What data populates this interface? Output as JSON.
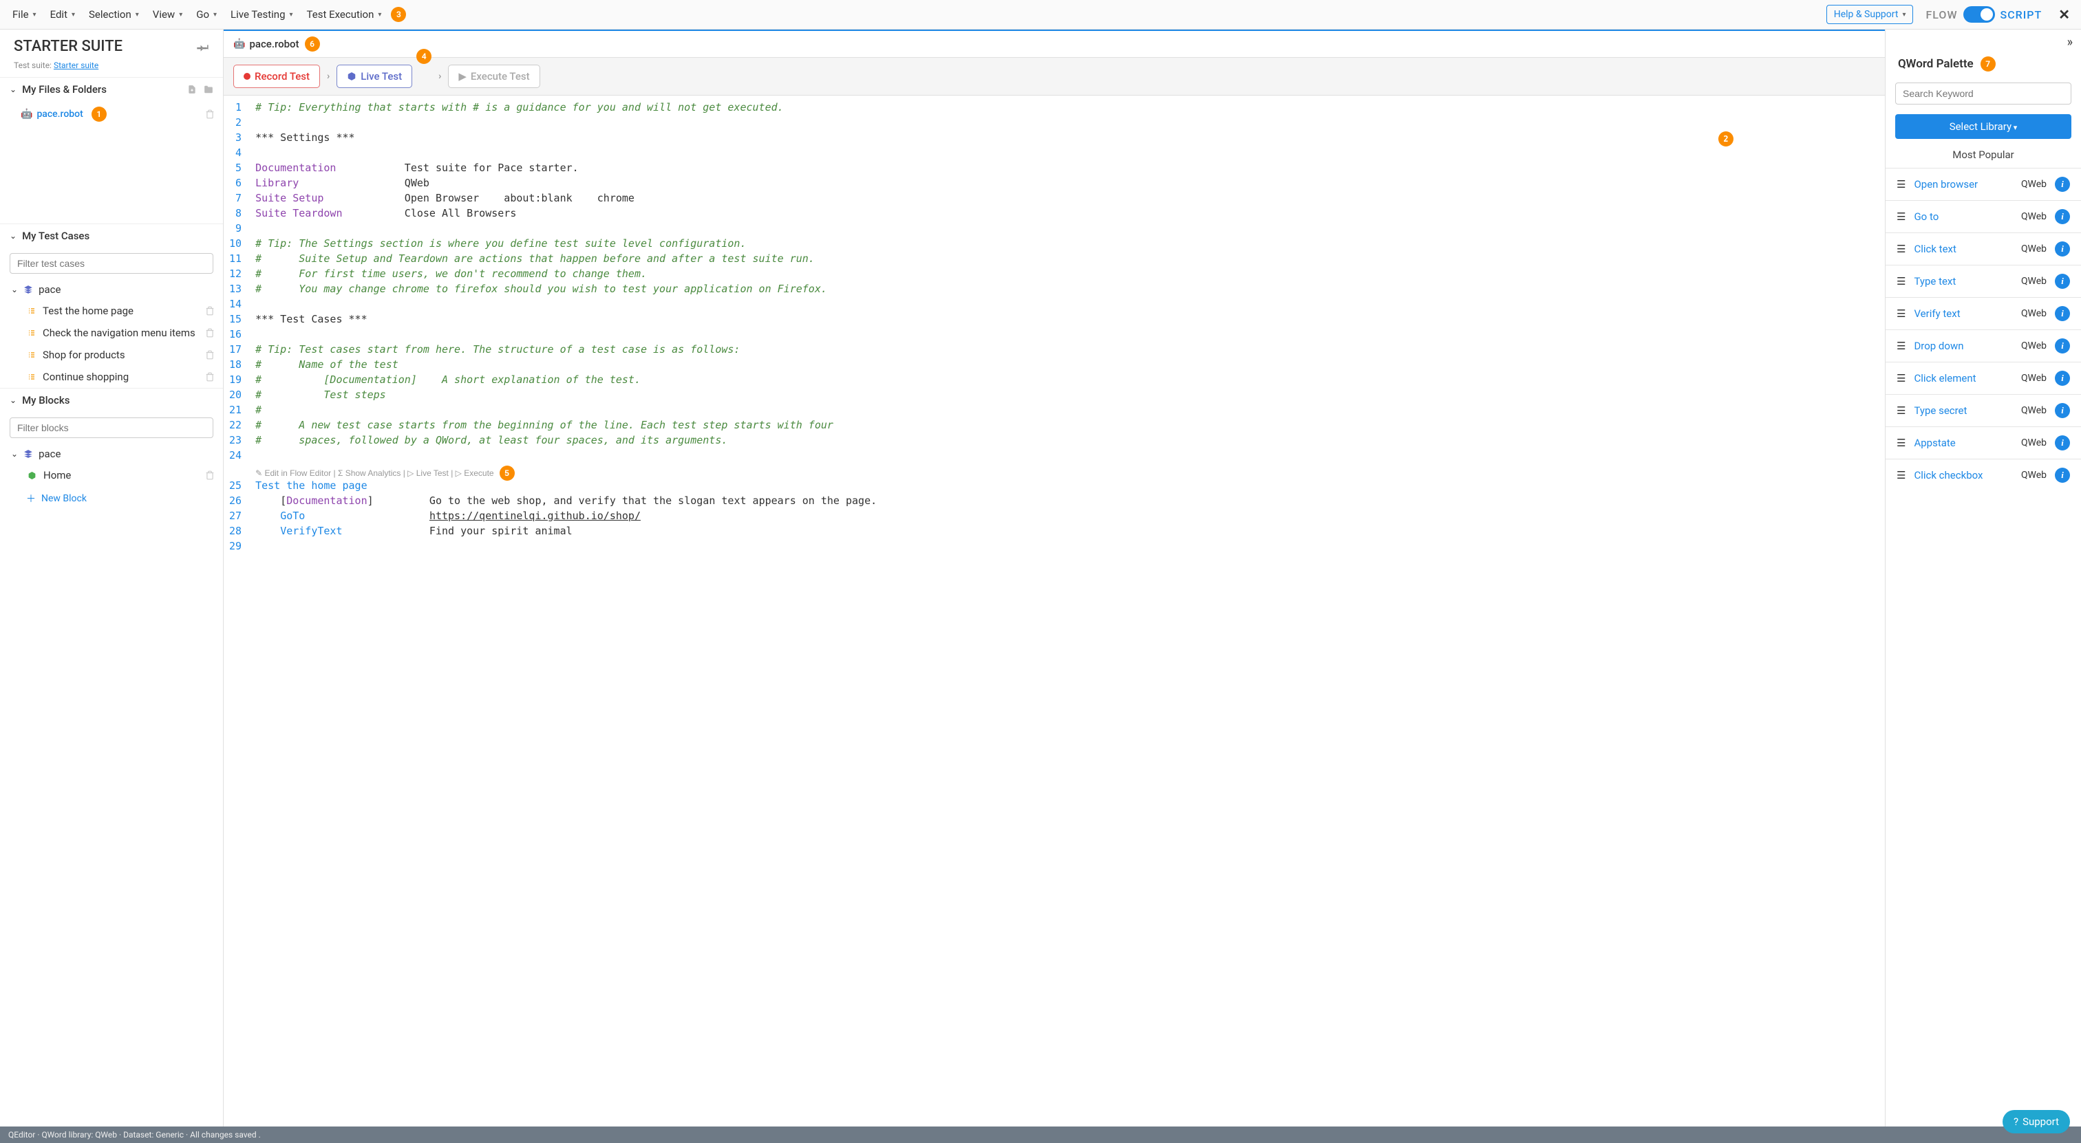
{
  "menubar": {
    "items": [
      "File",
      "Edit",
      "Selection",
      "View",
      "Go",
      "Live Testing",
      "Test Execution"
    ],
    "badge_after": "3"
  },
  "topright": {
    "help": "Help & Support",
    "flow": "FLOW",
    "script": "SCRIPT"
  },
  "suite": {
    "title": "STARTER SUITE",
    "sub_label": "Test suite: ",
    "sub_link": "Starter suite"
  },
  "files": {
    "header": "My Files & Folders",
    "items": [
      {
        "name": "pace.robot",
        "badge": "1"
      }
    ]
  },
  "testcases": {
    "header": "My Test Cases",
    "filter_placeholder": "Filter test cases",
    "folder": "pace",
    "items": [
      "Test the home page",
      "Check the navigation menu items",
      "Shop for products",
      "Continue shopping"
    ]
  },
  "blocks": {
    "header": "My Blocks",
    "filter_placeholder": "Filter blocks",
    "folder": "pace",
    "items": [
      "Home"
    ],
    "new_block": "New Block"
  },
  "tab": {
    "name": "pace.robot",
    "badge": "6"
  },
  "actions": {
    "record": "Record Test",
    "live": "Live Test",
    "live_badge": "4",
    "execute": "Execute Test"
  },
  "code": {
    "editor_badge": "2",
    "codelens": "✎ Edit in Flow Editor | Σ Show Analytics | ▷ Live Test | ▷ Execute",
    "codelens_badge": "5",
    "lines": [
      {
        "n": 1,
        "cls": "cm-comment",
        "t": "# Tip: Everything that starts with # is a guidance for you and will not get executed."
      },
      {
        "n": 2,
        "t": ""
      },
      {
        "n": 3,
        "cls": "cm-header",
        "t": "*** Settings ***"
      },
      {
        "n": 4,
        "t": ""
      },
      {
        "n": 5,
        "seg": [
          {
            "c": "cm-key",
            "t": "Documentation"
          },
          {
            "t": "           Test suite for Pace starter."
          }
        ]
      },
      {
        "n": 6,
        "seg": [
          {
            "c": "cm-key",
            "t": "Library"
          },
          {
            "t": "                 QWeb"
          }
        ]
      },
      {
        "n": 7,
        "seg": [
          {
            "c": "cm-key",
            "t": "Suite Setup"
          },
          {
            "t": "             Open Browser    about:blank    chrome"
          }
        ]
      },
      {
        "n": 8,
        "seg": [
          {
            "c": "cm-key",
            "t": "Suite Teardown"
          },
          {
            "t": "          Close All Browsers"
          }
        ]
      },
      {
        "n": 9,
        "t": ""
      },
      {
        "n": 10,
        "cls": "cm-comment",
        "t": "# Tip: The Settings section is where you define test suite level configuration."
      },
      {
        "n": 11,
        "cls": "cm-comment",
        "t": "#      Suite Setup and Teardown are actions that happen before and after a test suite run."
      },
      {
        "n": 12,
        "cls": "cm-comment",
        "t": "#      For first time users, we don't recommend to change them."
      },
      {
        "n": 13,
        "cls": "cm-comment",
        "t": "#      You may change chrome to firefox should you wish to test your application on Firefox."
      },
      {
        "n": 14,
        "t": ""
      },
      {
        "n": 15,
        "cls": "cm-header",
        "t": "*** Test Cases ***"
      },
      {
        "n": 16,
        "t": ""
      },
      {
        "n": 17,
        "cls": "cm-comment",
        "t": "# Tip: Test cases start from here. The structure of a test case is as follows:"
      },
      {
        "n": 18,
        "cls": "cm-comment",
        "t": "#      Name of the test"
      },
      {
        "n": 19,
        "cls": "cm-comment",
        "t": "#          [Documentation]    A short explanation of the test."
      },
      {
        "n": 20,
        "cls": "cm-comment",
        "t": "#          Test steps"
      },
      {
        "n": 21,
        "cls": "cm-comment",
        "t": "#"
      },
      {
        "n": 22,
        "cls": "cm-comment",
        "t": "#      A new test case starts from the beginning of the line. Each test step starts with four"
      },
      {
        "n": 23,
        "cls": "cm-comment",
        "t": "#      spaces, followed by a QWord, at least four spaces, and its arguments."
      },
      {
        "n": 24,
        "t": ""
      },
      {
        "n": 0,
        "codelens": true
      },
      {
        "n": 25,
        "seg": [
          {
            "c": "cm-kw",
            "t": "Test the home page"
          }
        ]
      },
      {
        "n": 26,
        "seg": [
          {
            "t": "    "
          },
          {
            "c": "cm-cell",
            "t": "["
          },
          {
            "c": "cm-key",
            "t": "Documentation"
          },
          {
            "c": "cm-cell",
            "t": "]"
          },
          {
            "t": "         Go to the web shop, and verify that the slogan text appears on the page."
          }
        ]
      },
      {
        "n": 27,
        "seg": [
          {
            "t": "    "
          },
          {
            "c": "cm-kw",
            "t": "GoTo"
          },
          {
            "t": "                    "
          },
          {
            "c": "cm-link",
            "t": "https://qentinelqi.github.io/shop/"
          }
        ]
      },
      {
        "n": 28,
        "seg": [
          {
            "t": "    "
          },
          {
            "c": "cm-kw",
            "t": "VerifyText"
          },
          {
            "t": "              Find your spirit animal"
          }
        ]
      },
      {
        "n": 29,
        "t": ""
      }
    ]
  },
  "palette": {
    "title": "QWord Palette",
    "badge": "7",
    "search_placeholder": "Search Keyword",
    "select_library": "Select Library",
    "popular": "Most Popular",
    "items": [
      {
        "name": "Open browser",
        "lib": "QWeb"
      },
      {
        "name": "Go to",
        "lib": "QWeb"
      },
      {
        "name": "Click text",
        "lib": "QWeb"
      },
      {
        "name": "Type text",
        "lib": "QWeb"
      },
      {
        "name": "Verify text",
        "lib": "QWeb"
      },
      {
        "name": "Drop down",
        "lib": "QWeb"
      },
      {
        "name": "Click element",
        "lib": "QWeb"
      },
      {
        "name": "Type secret",
        "lib": "QWeb"
      },
      {
        "name": "Appstate",
        "lib": "QWeb"
      },
      {
        "name": "Click checkbox",
        "lib": "QWeb"
      }
    ]
  },
  "status": "QEditor · QWord library: QWeb · Dataset: Generic · All changes saved .",
  "support": "Support"
}
